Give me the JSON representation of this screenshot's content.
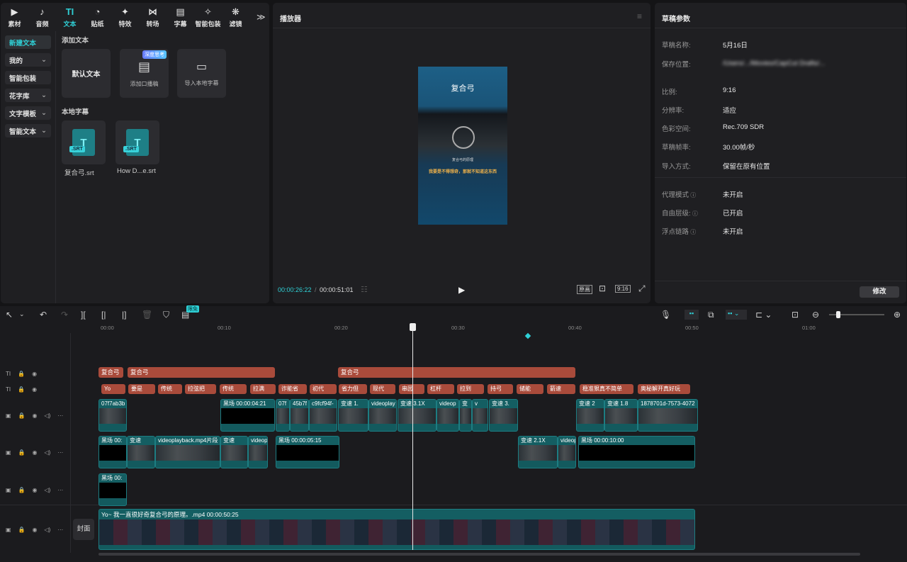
{
  "toolbar": {
    "items": [
      {
        "label": "素材",
        "icon": "media-icon"
      },
      {
        "label": "音频",
        "icon": "audio-icon"
      },
      {
        "label": "文本",
        "icon": "text-icon",
        "active": true
      },
      {
        "label": "贴纸",
        "icon": "sticker-icon"
      },
      {
        "label": "特效",
        "icon": "effects-icon"
      },
      {
        "label": "转场",
        "icon": "transition-icon"
      },
      {
        "label": "字幕",
        "icon": "caption-icon"
      },
      {
        "label": "智能包装",
        "icon": "smart-pack-icon"
      },
      {
        "label": "滤镜",
        "icon": "filter-icon"
      }
    ],
    "more": "≫"
  },
  "sidebar": {
    "items": [
      {
        "label": "新建文本",
        "active": true,
        "chevron": false
      },
      {
        "label": "我的",
        "chevron": true
      },
      {
        "label": "智能包装",
        "chevron": false
      },
      {
        "label": "花字库",
        "chevron": true
      },
      {
        "label": "文字模板",
        "chevron": true
      },
      {
        "label": "智能文本",
        "chevron": true
      }
    ]
  },
  "library": {
    "add_text_title": "添加文本",
    "default_text": "默认文本",
    "add_caption": "添加口播稿",
    "deep_think_badge": "深度思考",
    "import_local": "导入本地字幕",
    "local_title": "本地字幕",
    "srt_tag": ".SRT",
    "files": [
      "复合弓.srt",
      "How D...e.srt"
    ]
  },
  "player": {
    "title": "播放器",
    "video_title": "复合弓",
    "caption": "我要是不得想奇，那就不知道这东西",
    "small_caption": "复合弓的原理",
    "current_time": "00:00:26:22",
    "separator": "/",
    "total_time": "00:00:51:01",
    "btn_original": "原画",
    "btn_ratio": "9:16"
  },
  "draft": {
    "title": "草稿参数",
    "props": [
      {
        "label": "草稿名称:",
        "value": "5月16日"
      },
      {
        "label": "保存位置:",
        "value": "/Users/.../Movies/CapCut Drafts/..."
      },
      {
        "label": "比例:",
        "value": "9:16"
      },
      {
        "label": "分辨率:",
        "value": "适应"
      },
      {
        "label": "色彩空间:",
        "value": "Rec.709 SDR"
      },
      {
        "label": "草稿帧率:",
        "value": "30.00帧/秒"
      },
      {
        "label": "导入方式:",
        "value": "保留在原有位置"
      }
    ],
    "props2": [
      {
        "label": "代理模式",
        "value": "未开启"
      },
      {
        "label": "自由层级:",
        "value": "已开启"
      },
      {
        "label": "浮点链路",
        "value": "未开启"
      }
    ],
    "modify_btn": "修改"
  },
  "timeline": {
    "free_badge": "限免",
    "ruler": [
      "00:00",
      "00:10",
      "00:20",
      "00:30",
      "00:40",
      "00:50",
      "01:00"
    ],
    "text_clips": [
      "复合弓",
      "复合弓",
      "复合弓"
    ],
    "sub_clips": [
      "Yo",
      "要是",
      "传统",
      "拉弦把",
      "传统",
      "拉满",
      "诈能省",
      "初代",
      "省力但",
      "现代",
      "串园",
      "杠杆",
      "拉到",
      "持弓",
      "储能",
      "箭速",
      "稳准狠真不简单",
      "奥秘解开真好玩"
    ],
    "track1": [
      "07f7ab3b",
      "黑场  00:00:04:21",
      "07f",
      "45b7f",
      "c9fcf94f-",
      "变速 1.",
      "videoplay",
      "变速 3.1X",
      "videop",
      "变",
      "v",
      "变速 3.",
      "变速 2",
      "变速 1.8",
      "1878701d-7573-4072"
    ],
    "track2": [
      "黑场  00:",
      "变速",
      "videoplayback.mp4片段",
      "变速",
      "videop",
      "黑场  00:00:05:15",
      "变速 2.1X",
      "videop",
      "黑场  00:00:10:00"
    ],
    "track3": [
      "黑场  00:"
    ],
    "main_clip": "Yo~ 我一直很好奇复合弓的原理。.mp4   00:00:50:25",
    "cover_btn": "封面"
  }
}
